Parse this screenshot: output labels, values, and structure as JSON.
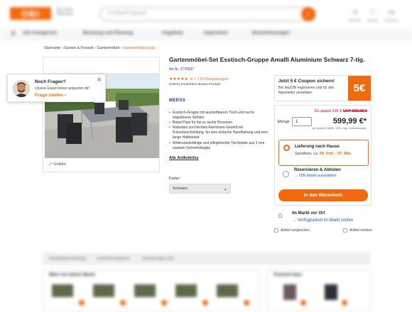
{
  "header": {
    "logo": "OBI",
    "claim": "Ein Ort für Menschen",
    "search_placeholder": "Suchbegriff eingeben",
    "icons": [
      "user-icon",
      "heart-icon",
      "cart-icon"
    ],
    "icon_labels": [
      "Anmelden",
      "Merkliste",
      "Warenkorb"
    ]
  },
  "nav": [
    "Alle Kategorien",
    "Beratung und Planung",
    "Angebote",
    "Inspiration",
    "Dienstleistungen"
  ],
  "breadcrumb": {
    "items": [
      "Startseite ›",
      "Garten & Freizeit ›",
      "Gartenmöbel ›"
    ],
    "current": "Gartenmöbel-Sets"
  },
  "chat": {
    "title": "Noch Fragen?",
    "text": "Unsere Expert:innen antworten dir!",
    "link": "Frage stellen"
  },
  "gallery": {
    "fullscreen": "Vollbild"
  },
  "product": {
    "title": "Gartenmöbel-Set Esstisch-Gruppe Amalfi Aluminium Schwarz 7-tlg.",
    "art_nr": "Art.Nr. 3775697",
    "stars": "★★★★★",
    "rating": "4.7",
    "reviews": "| 20 Bewertungen",
    "recommend": "(100%) empfehlen dieses Produkt",
    "brand": "MERXX",
    "bullets": [
      "Esstisch-Gruppe mit ausziehbarem Tisch und sechs stapelbaren Stühlen",
      "Bietet Platz für bis zu sechs Personen",
      "Robustes und leichtes Aluminium-Gestell mit Pulverbeschichtung, für eine einfache Handhabung und eine lange Haltbarkeit",
      "Widerstandsfähige und pflegeleichte Tischplatte aus 5 mm starkem Sicherheitsglas"
    ],
    "all_info": "Alle Artikelinfos",
    "color_label": "Farbe:",
    "color_value": "Schwarz"
  },
  "coupon": {
    "title": "Jetzt 5 € Coupon sichern!",
    "text": "Bei heyOBI registrieren und für den Newsletter anmelden.",
    "badge": "5€"
  },
  "pricebox": {
    "savings": "Du sparst 295 €",
    "old_price": "UVP 895,98 €",
    "quantity_label": "Menge",
    "quantity": "1",
    "price": "599,99 €*",
    "note": "inkl. gesetzl. MwSt. 19%, zzgl. Versandkosten",
    "delivery_title": "Lieferung nach Hause",
    "delivery_sub": "Spedition, ca.",
    "delivery_date": "29. Feb. - 07. Mär.",
    "pickup_title": "Reservieren & Abholen",
    "pickup_link": "→ OBI Markt auswählen",
    "cart_button": "In den Warenkorb"
  },
  "store": {
    "title": "Im Markt vor Ort",
    "link": "→ Verfügbarkeit im Markt prüfen",
    "compare": "Artikel vergleichen",
    "remember": "Artikel merken"
  },
  "bottom": {
    "tabs": [
      "Produktbeschreibung",
      "Lieferinformationen",
      "Bewertungen (20)"
    ],
    "rec1_title": "Mehr von dieser Marke",
    "rec2_title": "Passend dazu"
  },
  "colors": {
    "accent": "#f26a10",
    "link": "#1a5fb4",
    "sale": "#e2001a"
  }
}
